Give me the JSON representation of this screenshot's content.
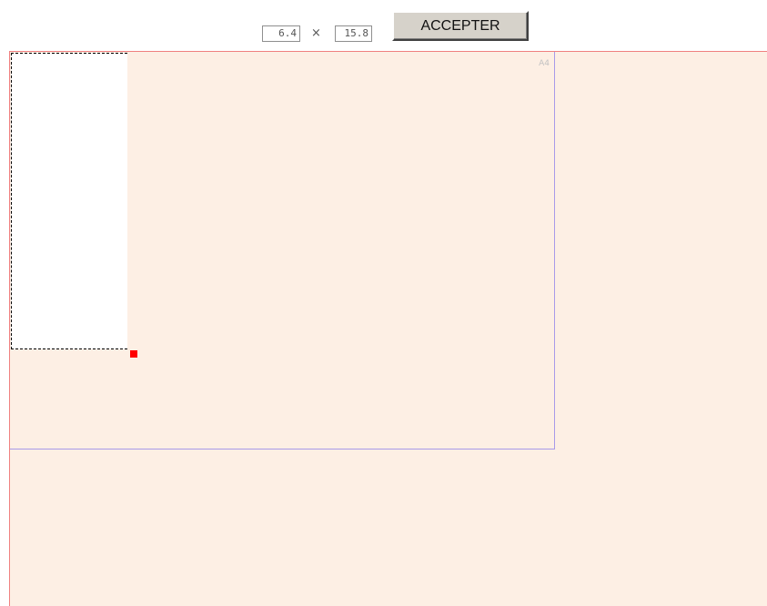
{
  "toolbar": {
    "width_value": "6.4",
    "times_symbol": "×",
    "height_value": "15.8",
    "accept_label": "ACCEPTER"
  },
  "canvas": {
    "page_format_label": "A4",
    "colors": {
      "canvas_background": "#fdefe4",
      "canvas_border": "#f08080",
      "page_frame": "#a89ae8",
      "selection_fill": "#ffffff",
      "handle": "#ff0000"
    }
  }
}
